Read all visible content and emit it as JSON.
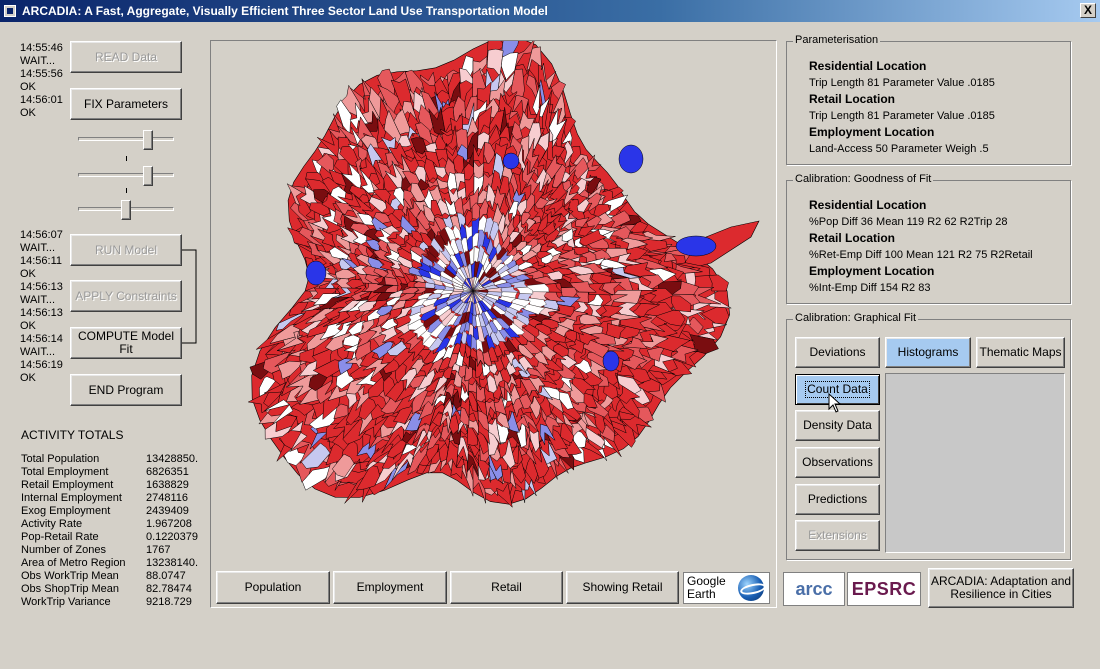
{
  "window": {
    "title": "ARCADIA: A Fast, Aggregate, Visually Efficient  Three Sector Land Use Transportation Model",
    "close": "X"
  },
  "controls": {
    "read": "READ Data",
    "fix": "FIX Parameters",
    "run": "RUN Model",
    "apply": "APPLY Constraints",
    "compute": "COMPUTE Model Fit",
    "end": "END Program"
  },
  "log_top": [
    "14:55:46",
    "WAIT...",
    "14:55:56",
    "OK",
    "14:56:01",
    "OK"
  ],
  "log_bottom": [
    "14:56:07",
    "WAIT...",
    "14:56:11",
    "OK",
    "14:56:13",
    "WAIT...",
    "14:56:13",
    "OK",
    "14:56:14",
    "WAIT...",
    "14:56:19",
    "OK"
  ],
  "sliders": [
    {
      "level": 0.75
    },
    {
      "level": 0.75
    },
    {
      "level": 0.5
    }
  ],
  "totals": {
    "title": "ACTIVITY TOTALS",
    "rows": [
      {
        "label": "Total Population",
        "value": "13428850."
      },
      {
        "label": "Total Employment",
        "value": "6826351"
      },
      {
        "label": "Retail Employment",
        "value": "1638829"
      },
      {
        "label": "Internal Employment",
        "value": "2748116"
      },
      {
        "label": "Exog Employment",
        "value": "2439409"
      },
      {
        "label": "Activity Rate",
        "value": "1.967208"
      },
      {
        "label": "Pop-Retail Rate",
        "value": "0.1220379"
      },
      {
        "label": "Number of Zones",
        "value": "1767"
      },
      {
        "label": "Area of Metro Region",
        "value": "13238140."
      },
      {
        "label": "Obs WorkTrip Mean",
        "value": "88.0747"
      },
      {
        "label": "Obs ShopTrip Mean",
        "value": "82.78474"
      },
      {
        "label": "WorkTrip Variance",
        "value": "9218.729"
      }
    ]
  },
  "map_tabs": {
    "population": "Population",
    "employment": "Employment",
    "retail": "Retail",
    "showing": "Showing Retail",
    "google_earth_1": "Google",
    "google_earth_2": "Earth"
  },
  "parameterisation": {
    "title": "Parameterisation",
    "res_h": "Residential Location",
    "res_v": "Trip Length  81 Parameter Value .0185",
    "ret_h": "Retail Location",
    "ret_v": "Trip Length  81 Parameter Value .0185",
    "emp_h": "Employment Location",
    "emp_v": "Land-Access  50 Parameter Weigh .5"
  },
  "goodness": {
    "title": "Calibration: Goodness of Fit",
    "res_h": "Residential Location",
    "res_v": "%Pop Diff  36 Mean 119 R2 62 R2Trip 28",
    "ret_h": "Retail Location",
    "ret_v": "%Ret-Emp Diff  100 Mean 121 R2 75 R2Retail",
    "emp_h": "Employment Location",
    "emp_v": "%Int-Emp Diff  154 R2 83"
  },
  "graphical": {
    "title": "Calibration: Graphical Fit",
    "deviations": "Deviations",
    "histograms": "Histograms",
    "thematic": "Thematic Maps",
    "count": "Count Data",
    "density": "Density Data",
    "observations": "Observations",
    "predictions": "Predictions",
    "extensions": "Extensions"
  },
  "logos": {
    "arcc": "arcc",
    "epsrc": "EPSRC"
  },
  "arcadia_button": "ARCADIA: Adaptation and Resilience in Cities",
  "map_colors": {
    "strong_red": "#dc2a2e",
    "mid_red": "#e5585c",
    "light_red": "#ef9a9a",
    "pale_red": "#f7cdd0",
    "dark_red": "#7a0d10",
    "white": "#ffffff",
    "pale_blue": "#c6c8f0",
    "mid_blue": "#8a8ee8",
    "strong_blue": "#2a35e8"
  }
}
